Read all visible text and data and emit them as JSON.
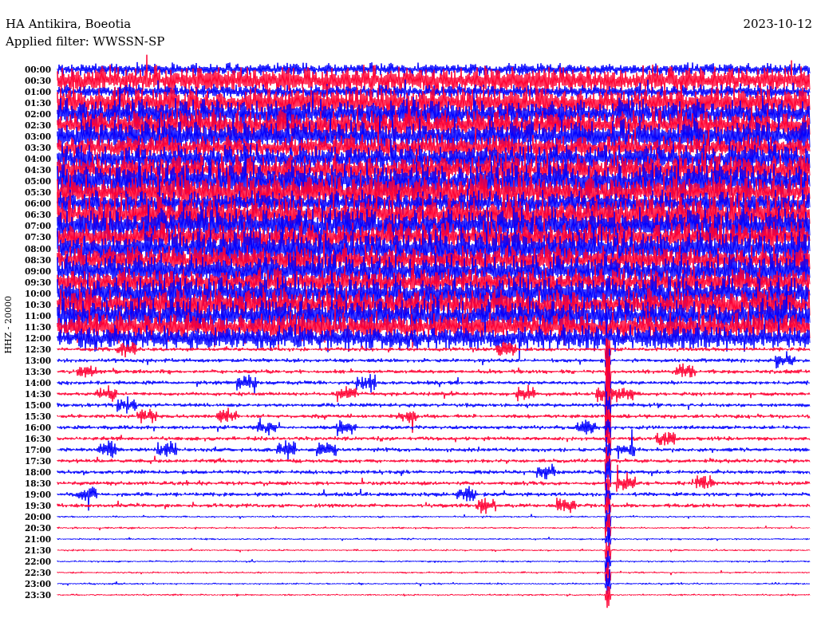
{
  "station": "HA Antikira, Boeotia",
  "date": "2023-10-12",
  "filter": "Applied filter: WWSSN-SP",
  "channel_label": "HHZ - 20000",
  "rows": [
    {
      "time": "00:00",
      "color": "#0000ff"
    },
    {
      "time": "00:30",
      "color": "#ff0033"
    },
    {
      "time": "01:00",
      "color": "#0000ff"
    },
    {
      "time": "01:30",
      "color": "#ff0033"
    },
    {
      "time": "02:00",
      "color": "#0000ff"
    },
    {
      "time": "02:30",
      "color": "#ff0033"
    },
    {
      "time": "03:00",
      "color": "#0000ff"
    },
    {
      "time": "03:30",
      "color": "#ff0033"
    },
    {
      "time": "04:00",
      "color": "#0000ff"
    },
    {
      "time": "04:30",
      "color": "#ff0033"
    },
    {
      "time": "05:00",
      "color": "#0000ff"
    },
    {
      "time": "05:30",
      "color": "#ff0033"
    },
    {
      "time": "06:00",
      "color": "#0000ff"
    },
    {
      "time": "06:30",
      "color": "#ff0033"
    },
    {
      "time": "07:00",
      "color": "#0000ff"
    },
    {
      "time": "07:30",
      "color": "#ff0033"
    },
    {
      "time": "08:00",
      "color": "#0000ff"
    },
    {
      "time": "08:30",
      "color": "#ff0033"
    },
    {
      "time": "09:00",
      "color": "#0000ff"
    },
    {
      "time": "09:30",
      "color": "#ff0033"
    },
    {
      "time": "10:00",
      "color": "#0000ff"
    },
    {
      "time": "10:30",
      "color": "#ff0033"
    },
    {
      "time": "11:00",
      "color": "#0000ff"
    },
    {
      "time": "11:30",
      "color": "#ff0033"
    },
    {
      "time": "12:00",
      "color": "#0000ff"
    },
    {
      "time": "12:30",
      "color": "#ff0033"
    },
    {
      "time": "13:00",
      "color": "#0000ff"
    },
    {
      "time": "13:30",
      "color": "#ff0033"
    },
    {
      "time": "14:00",
      "color": "#0000ff"
    },
    {
      "time": "14:30",
      "color": "#ff0033"
    },
    {
      "time": "15:00",
      "color": "#0000ff"
    },
    {
      "time": "15:30",
      "color": "#ff0033"
    },
    {
      "time": "16:00",
      "color": "#0000ff"
    },
    {
      "time": "16:30",
      "color": "#ff0033"
    },
    {
      "time": "17:00",
      "color": "#0000ff"
    },
    {
      "time": "17:30",
      "color": "#ff0033"
    },
    {
      "time": "18:00",
      "color": "#0000ff"
    },
    {
      "time": "18:30",
      "color": "#ff0033"
    },
    {
      "time": "19:00",
      "color": "#0000ff"
    },
    {
      "time": "19:30",
      "color": "#ff0033"
    },
    {
      "time": "20:00",
      "color": "#0000ff"
    },
    {
      "time": "20:30",
      "color": "#ff0033"
    },
    {
      "time": "21:00",
      "color": "#0000ff"
    },
    {
      "time": "21:30",
      "color": "#ff0033"
    },
    {
      "time": "22:00",
      "color": "#0000ff"
    },
    {
      "time": "22:30",
      "color": "#ff0033"
    },
    {
      "time": "23:00",
      "color": "#0000ff"
    },
    {
      "time": "23:30",
      "color": "#ff0033"
    }
  ]
}
